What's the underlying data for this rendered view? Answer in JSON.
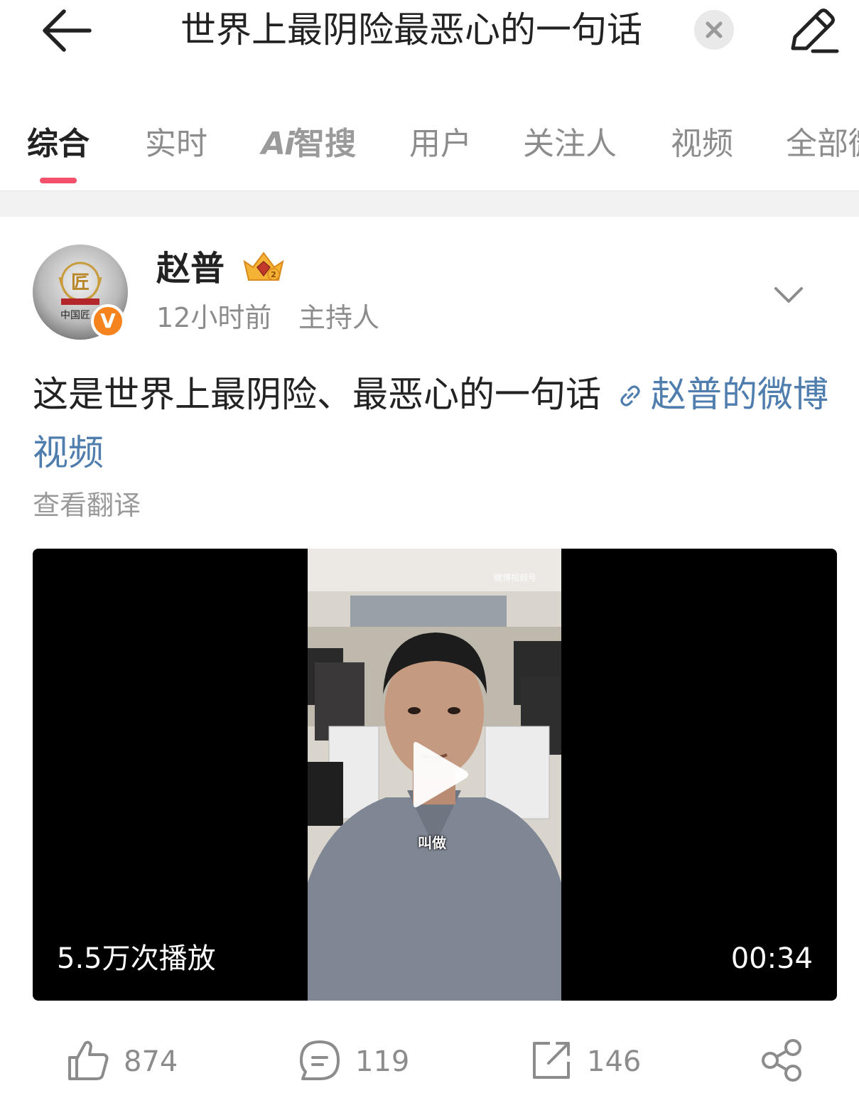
{
  "header": {
    "query": "世界上最阴险最恶心的一句话",
    "back_icon": "arrow-left-icon",
    "clear_icon": "close-icon",
    "edit_icon": "pencil-icon"
  },
  "tabs": [
    {
      "label": "综合",
      "active": true
    },
    {
      "label": "实时"
    },
    {
      "label_ai": "Ai",
      "label": "智搜"
    },
    {
      "label": "用户"
    },
    {
      "label": "关注人"
    },
    {
      "label": "视频"
    },
    {
      "label": "全部微博"
    }
  ],
  "post": {
    "author": "赵普",
    "avatar_text": "中国匠人",
    "avatar_badge": "V",
    "avatar_emblem": "匠",
    "time": "12小时前",
    "role": "主持人",
    "text": "这是世界上最阴险、最恶心的一句话",
    "link_text": "赵普的微博视频",
    "translate": "查看翻译",
    "video": {
      "views": "5.5万次播放",
      "duration": "00:34",
      "subtitle": "叫做",
      "watermark": "微博视频号"
    }
  },
  "actions": {
    "likes": "874",
    "comments": "119",
    "reposts": "146"
  },
  "colors": {
    "accent": "#f2506b",
    "link": "#4f7dad",
    "verified": "#f5841f",
    "muted": "#8c8c8c"
  }
}
